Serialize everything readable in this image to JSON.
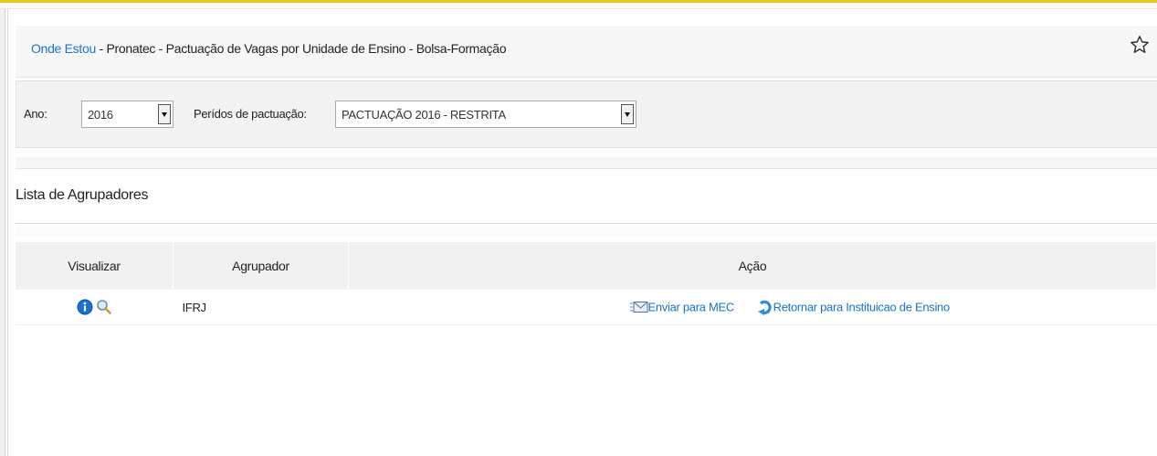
{
  "breadcrumb": {
    "link": "Onde Estou",
    "path": " - Pronatec - Pactuação de Vagas por Unidade de Ensino - Bolsa-Formação"
  },
  "filters": {
    "ano_label": "Ano:",
    "ano_value": "2016",
    "periodo_label": "Perídos de pactuação:",
    "periodo_value": "PACTUAÇÃO 2016 - RESTRITA"
  },
  "section": {
    "title": "Lista de Agrupadores"
  },
  "table": {
    "headers": [
      "Visualizar",
      "Agrupador",
      "Ação"
    ],
    "rows": [
      {
        "agrupador": "IFRJ",
        "acao_enviar": "Enviar para MEC",
        "acao_retornar": "Retornar para Instituicao de Ensino"
      }
    ]
  },
  "icons": {
    "star": "star-icon",
    "info": "info-icon",
    "magnifier": "magnifier-icon",
    "send": "send-mail-icon",
    "return": "return-arrow-icon"
  },
  "colors": {
    "accent": "#e8c81a",
    "link": "#1a73c8"
  }
}
